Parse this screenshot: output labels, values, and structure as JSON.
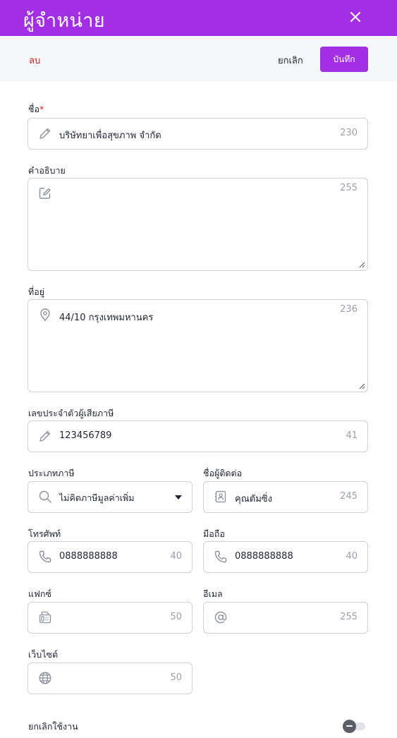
{
  "header": {
    "title": "ผู้จำหน่าย"
  },
  "actions": {
    "delete_label": "ลบ",
    "cancel_label": "ยกเลิก",
    "save_label": "บันทึก"
  },
  "form": {
    "name": {
      "label": "ชื่อ",
      "required_mark": "*",
      "value": "บริษัทยาเพื่อสุขภาพ จำกัด",
      "remaining": "230",
      "icon": "pencil-icon"
    },
    "description": {
      "label": "คำอธิบาย",
      "value": "",
      "remaining": "255",
      "icon": "edit-icon"
    },
    "address": {
      "label": "ที่อยู่",
      "value": "44/10 กรุงเทพมหานคร",
      "remaining": "236",
      "icon": "location-pin-icon"
    },
    "tax_id": {
      "label": "เลขประจำตัวผู้เสียภาษี",
      "value": "123456789",
      "remaining": "41",
      "icon": "pencil-icon"
    },
    "tax_type": {
      "label": "ประเภทภาษี",
      "value": "ไม่คิดภาษีมูลค่าเพิ่ม",
      "icon": "search-icon"
    },
    "contact": {
      "label": "ชื่อผู้ติดต่อ",
      "value": "คุณตัมซิ่ง",
      "remaining": "245",
      "icon": "contact-card-icon"
    },
    "phone": {
      "label": "โทรศัพท์",
      "value": "0888888888",
      "remaining": "40",
      "icon": "phone-icon"
    },
    "mobile": {
      "label": "มือถือ",
      "value": "0888888888",
      "remaining": "40",
      "icon": "phone-icon"
    },
    "fax": {
      "label": "แฟกซ์",
      "value": "",
      "remaining": "50",
      "icon": "fax-icon"
    },
    "email": {
      "label": "อีเมล",
      "value": "",
      "remaining": "255",
      "icon": "at-icon"
    },
    "website": {
      "label": "เว็บไซต์",
      "value": "",
      "remaining": "50",
      "icon": "globe-icon"
    },
    "deactivate": {
      "label": "ยกเลิกใช้งาน",
      "enabled": false
    }
  },
  "colors": {
    "brand": "#a22fe3",
    "danger": "#d11a1a",
    "border": "#ccd0d8",
    "muted": "#9aa0ab"
  }
}
